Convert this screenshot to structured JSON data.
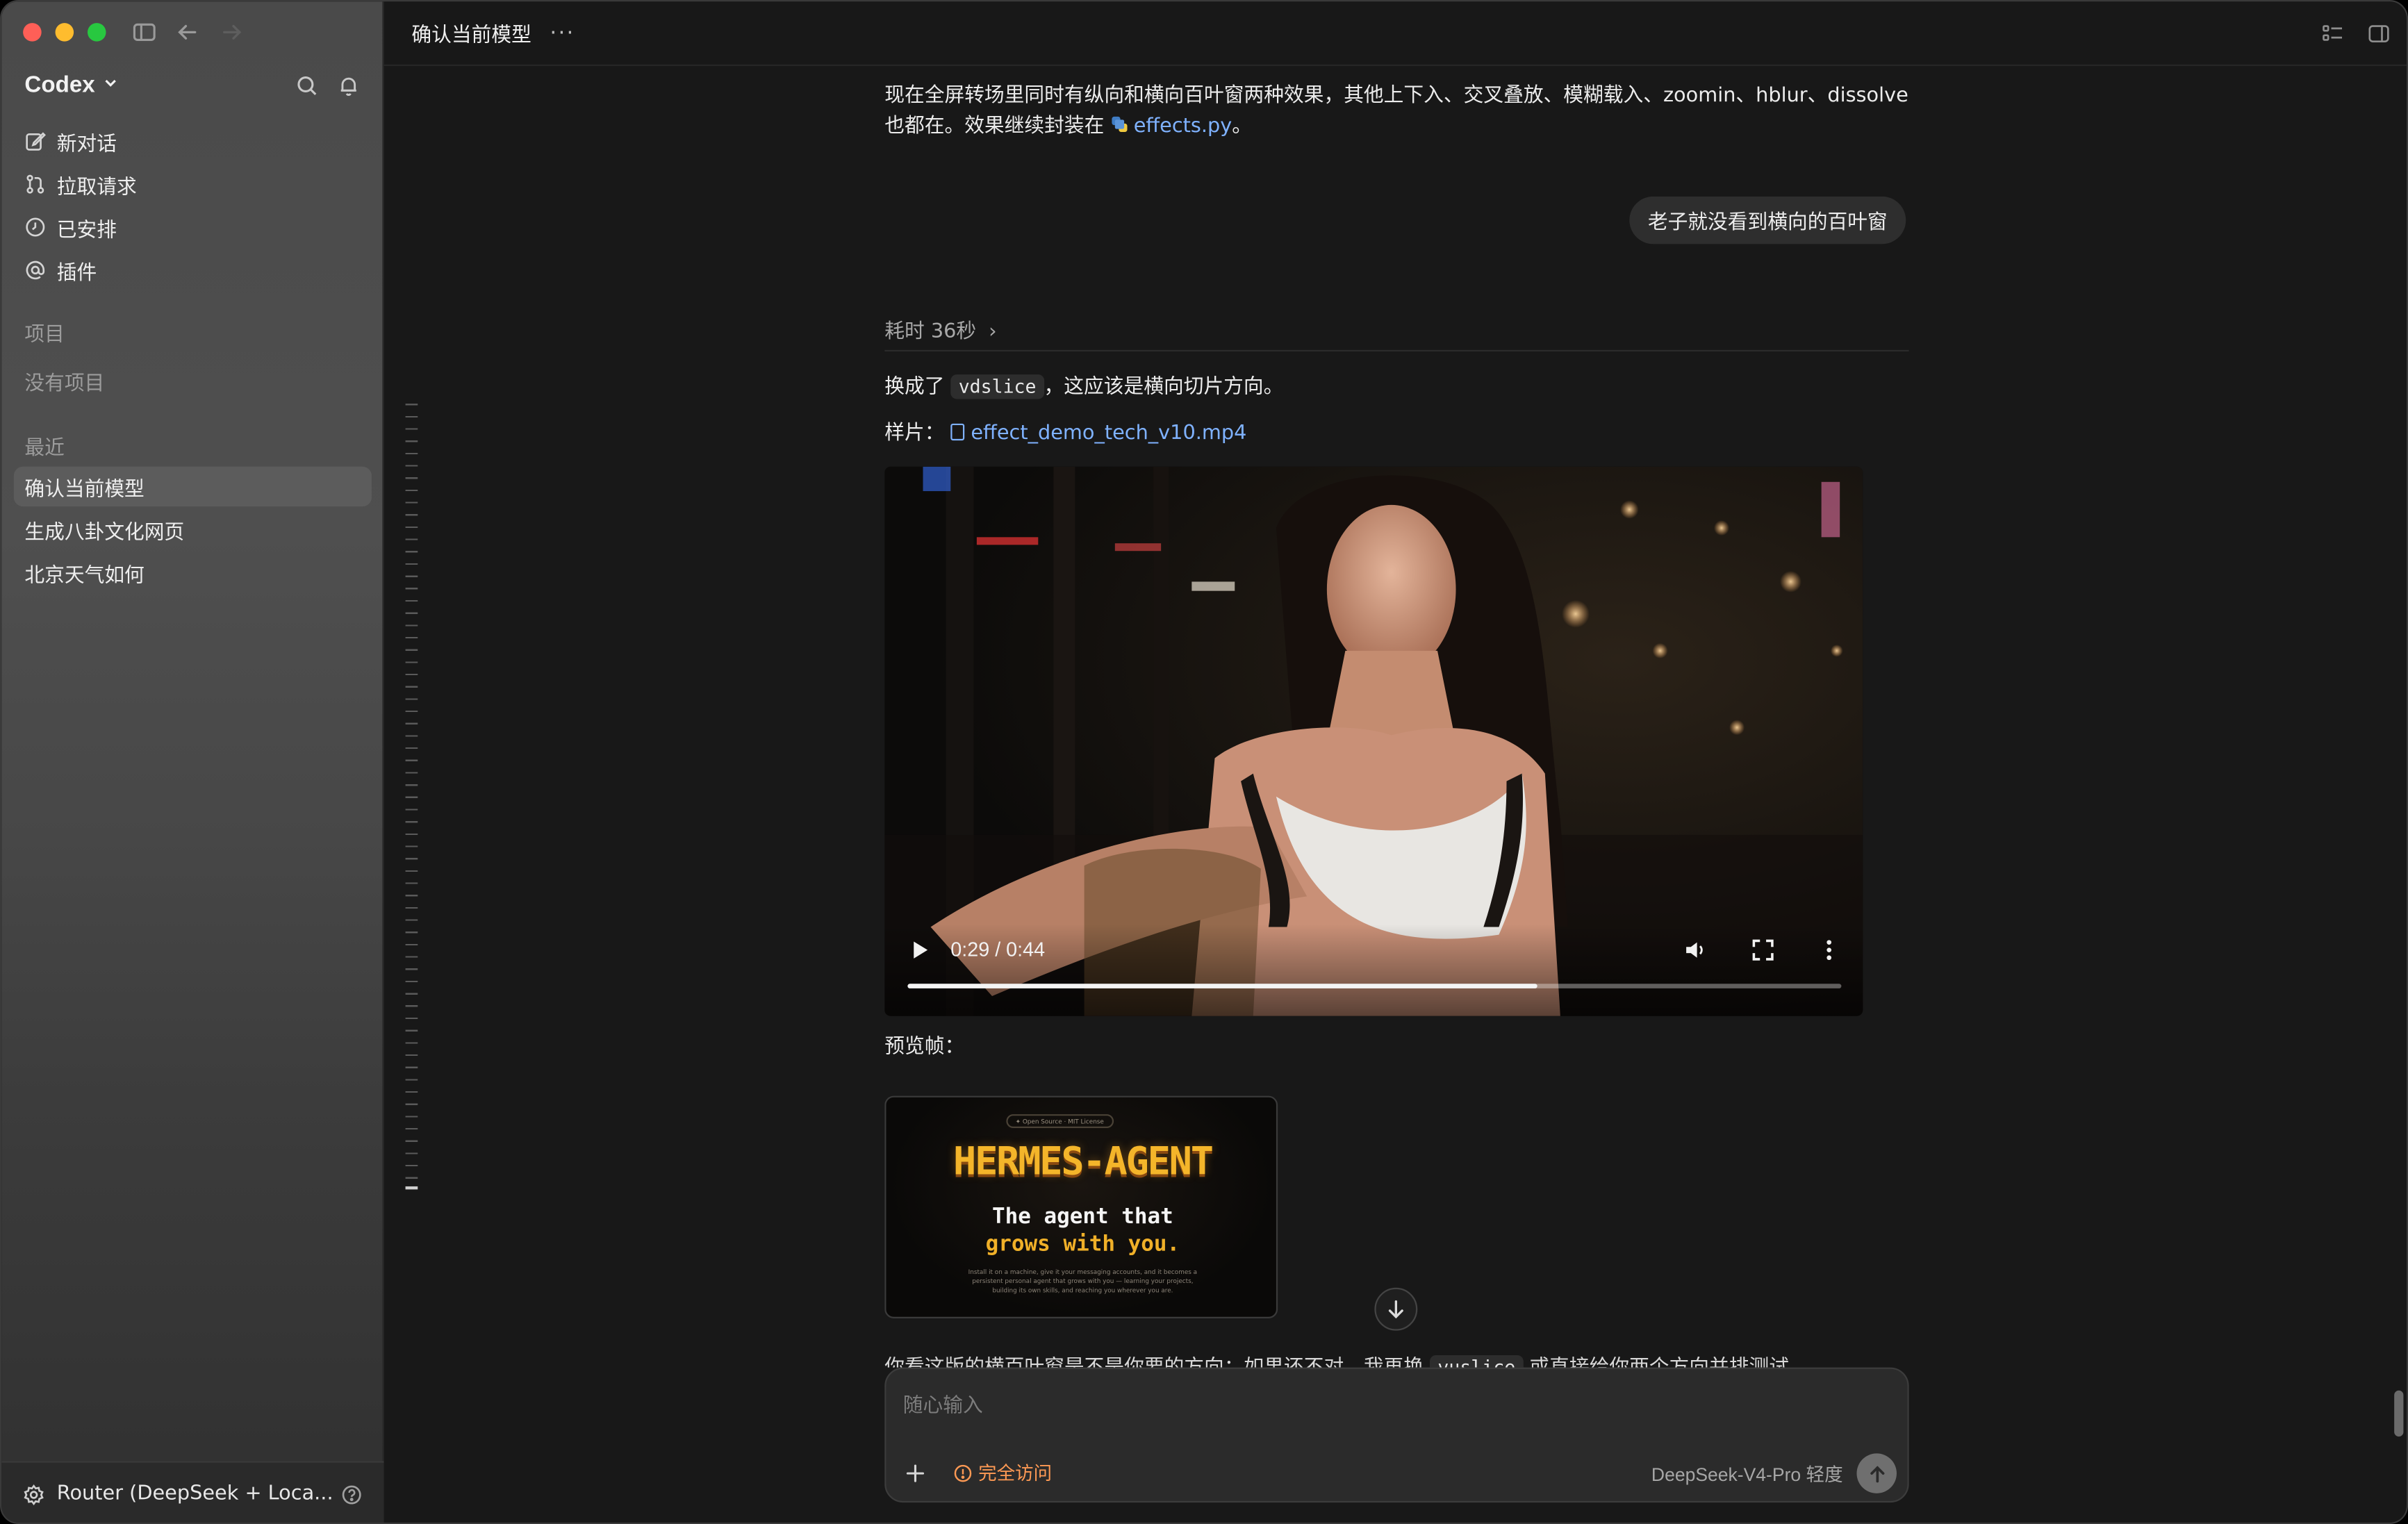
{
  "window": {
    "sidebar_toggle_icon": "sidebar-icon",
    "back_icon": "arrow-left-icon",
    "forward_icon": "arrow-right-icon"
  },
  "sidebar": {
    "brand": "Codex",
    "nav": [
      {
        "label": "新对话",
        "icon": "edit-icon"
      },
      {
        "label": "拉取请求",
        "icon": "pull-request-icon"
      },
      {
        "label": "已安排",
        "icon": "clock-icon"
      },
      {
        "label": "插件",
        "icon": "at-icon"
      }
    ],
    "projects_label": "项目",
    "no_projects": "没有项目",
    "recent_label": "最近",
    "recent": [
      {
        "label": "确认当前模型",
        "active": true
      },
      {
        "label": "生成八卦文化网页",
        "active": false
      },
      {
        "label": "北京天气如何",
        "active": false
      }
    ],
    "footer_label": "Router (DeepSeek + Loca..."
  },
  "header": {
    "title": "确认当前模型",
    "more": "···"
  },
  "conversation": {
    "intro_text": "现在全屏转场里同时有纵向和横向百叶窗两种效果，其他上下入、交叉叠放、模糊载入、zoomin、hblur、dissolve 也都在。效果继续封装在",
    "intro_link": "effects.py",
    "intro_end": "。",
    "user_message": "老子就没看到横向的百叶窗",
    "elapsed": "耗时 36秒",
    "reply_pre": "换成了",
    "reply_code": "vdslice",
    "reply_post": "，这应该是横向切片方向。",
    "sample_label": "样片：",
    "sample_file": "effect_demo_tech_v10.mp4",
    "video_time": "0:29 / 0:44",
    "video_progress": 0.675,
    "preview_label": "预览帧：",
    "preview": {
      "pill": "✦ Open Source · MIT License",
      "hero": "HERMES-AGENT",
      "line1": "The agent that",
      "line2": "grows with you.",
      "small": "Install it on a machine, give it your messaging accounts, and it becomes a persistent personal agent that grows with you — learning your projects, building its own skills, and reaching you wherever you are."
    },
    "cut_line_pre": "你看这版的横百叶窗是不是你要的方向；如果还不对，我再换",
    "cut_line_code": "vuslice",
    "cut_line_post": "或直接给你两个方向并排测试"
  },
  "composer": {
    "placeholder": "随心输入",
    "access_label": "完全访问",
    "model_label": "DeepSeek-V4-Pro  轻度"
  },
  "colors": {
    "accent_link": "#7fb2ff",
    "warning": "#ff9a54",
    "sidebar_active": "#5c5c5c"
  }
}
